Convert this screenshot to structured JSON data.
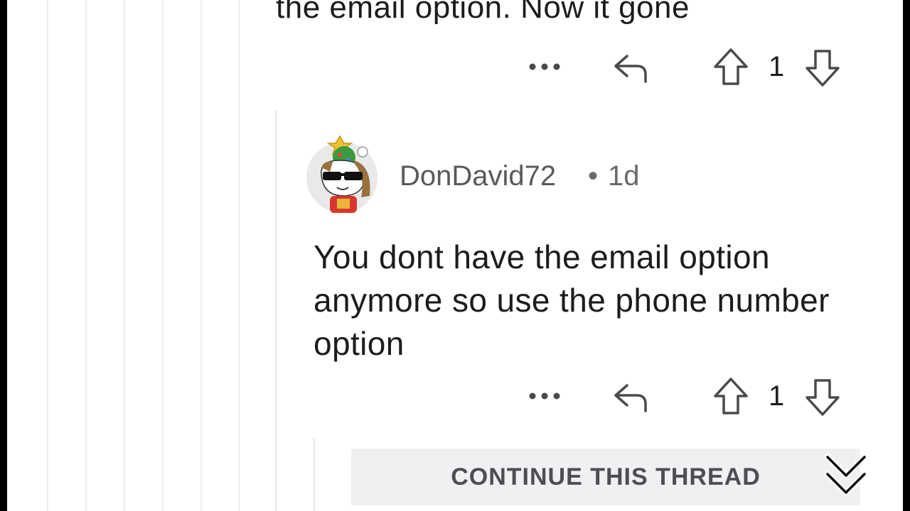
{
  "parent_comment": {
    "text_tail": "the email option. Now it gone",
    "vote_count": "1"
  },
  "reply": {
    "username": "DonDavid72",
    "separator": "•",
    "age": "1d",
    "text": "You dont have the email option anymore so use the phone number option",
    "vote_count": "1"
  },
  "continue_thread": {
    "label": "CONTINUE THIS THREAD"
  },
  "icons": {
    "more": "more-options-icon",
    "reply": "reply-icon",
    "upvote": "upvote-icon",
    "downvote": "downvote-icon",
    "scroll": "scroll-down-icon"
  }
}
